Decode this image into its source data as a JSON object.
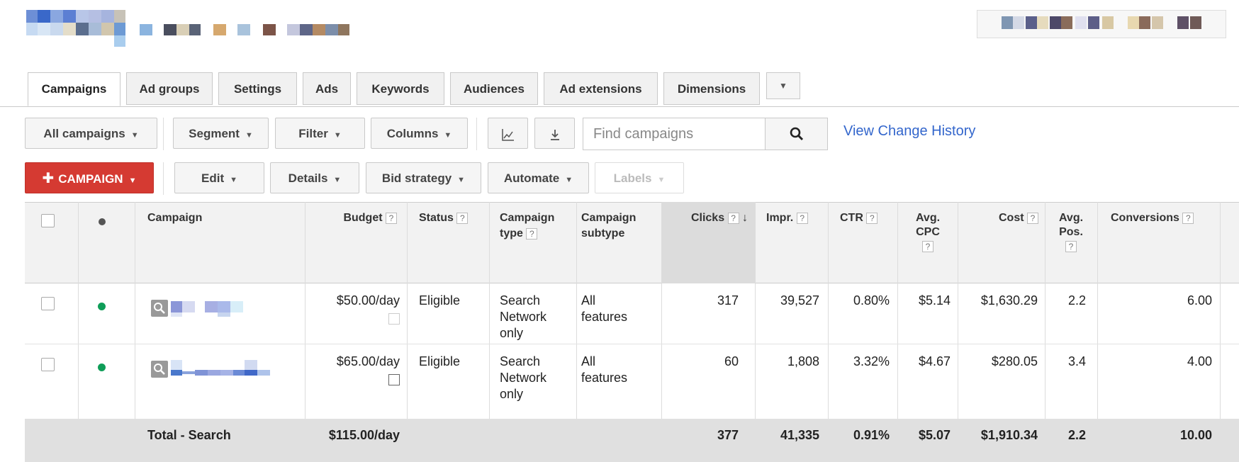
{
  "tabs": {
    "items": [
      "Campaigns",
      "Ad groups",
      "Settings",
      "Ads",
      "Keywords",
      "Audiences",
      "Ad extensions",
      "Dimensions"
    ],
    "more_icon": "chevron-down-icon"
  },
  "toolbar": {
    "all_campaigns": "All campaigns",
    "segment": "Segment",
    "filter": "Filter",
    "columns": "Columns",
    "chart_icon": "line-chart-icon",
    "download_icon": "download-icon",
    "search_placeholder": "Find campaigns",
    "search_icon": "search-icon",
    "view_history": "View Change History"
  },
  "actions": {
    "campaign": "CAMPAIGN",
    "edit": "Edit",
    "details": "Details",
    "bid_strategy": "Bid strategy",
    "automate": "Automate",
    "labels": "Labels"
  },
  "table": {
    "headers": {
      "campaign": "Campaign",
      "budget": "Budget",
      "status": "Status",
      "campaign_type_1": "Campaign",
      "campaign_type_2": "type",
      "campaign_subtype_1": "Campaign",
      "campaign_subtype_2": "subtype",
      "clicks": "Clicks",
      "impr": "Impr.",
      "ctr": "CTR",
      "avg_cpc_1": "Avg.",
      "avg_cpc_2": "CPC",
      "cost": "Cost",
      "avg_pos_1": "Avg.",
      "avg_pos_2": "Pos.",
      "conversions": "Conversions",
      "help": "?"
    },
    "rows": [
      {
        "budget": "$50.00/day",
        "status": "Eligible",
        "type_1": "Search",
        "type_2": "Network",
        "type_3": "only",
        "subtype_1": "All",
        "subtype_2": "features",
        "clicks": "317",
        "impr": "39,527",
        "ctr": "0.80%",
        "avg_cpc": "$5.14",
        "cost": "$1,630.29",
        "avg_pos": "2.2",
        "conversions": "6.00"
      },
      {
        "budget": "$65.00/day",
        "status": "Eligible",
        "type_1": "Search",
        "type_2": "Network",
        "type_3": "only",
        "subtype_1": "All",
        "subtype_2": "features",
        "clicks": "60",
        "impr": "1,808",
        "ctr": "3.32%",
        "avg_cpc": "$4.67",
        "cost": "$280.05",
        "avg_pos": "3.4",
        "conversions": "4.00"
      }
    ],
    "total": {
      "label": "Total - Search",
      "budget": "$115.00/day",
      "clicks": "377",
      "impr": "41,335",
      "ctr": "0.91%",
      "avg_cpc": "$5.07",
      "cost": "$1,910.34",
      "avg_pos": "2.2",
      "conversions": "10.00"
    }
  },
  "colors": {
    "accent_red": "#d53a32",
    "link_blue": "#3366cc",
    "status_green": "#0f9d58"
  }
}
